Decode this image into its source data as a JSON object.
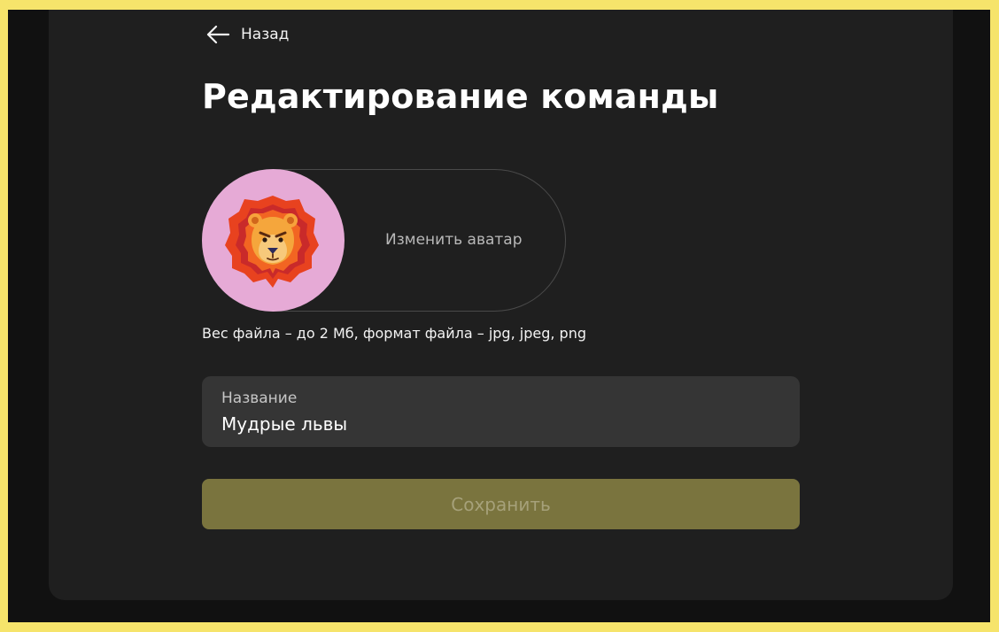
{
  "header": {
    "back_label": "Назад",
    "back_icon": "arrow-left-icon"
  },
  "page": {
    "title": "Редактирование команды"
  },
  "avatar": {
    "change_label": "Изменить аватар",
    "image_description_icon": "lion-avatar",
    "background_color": "#e6aad6",
    "hint": "Вес файла – до 2 Мб, формат файла – jpg, jpeg, png"
  },
  "form": {
    "name_label": "Название",
    "name_value": "Мудрые львы"
  },
  "actions": {
    "save_label": "Сохранить",
    "save_color": "#7a743e"
  },
  "colors": {
    "outer_border": "#f6e46b",
    "background": "#111111",
    "card": "#1f1f1f",
    "field": "#353535"
  }
}
